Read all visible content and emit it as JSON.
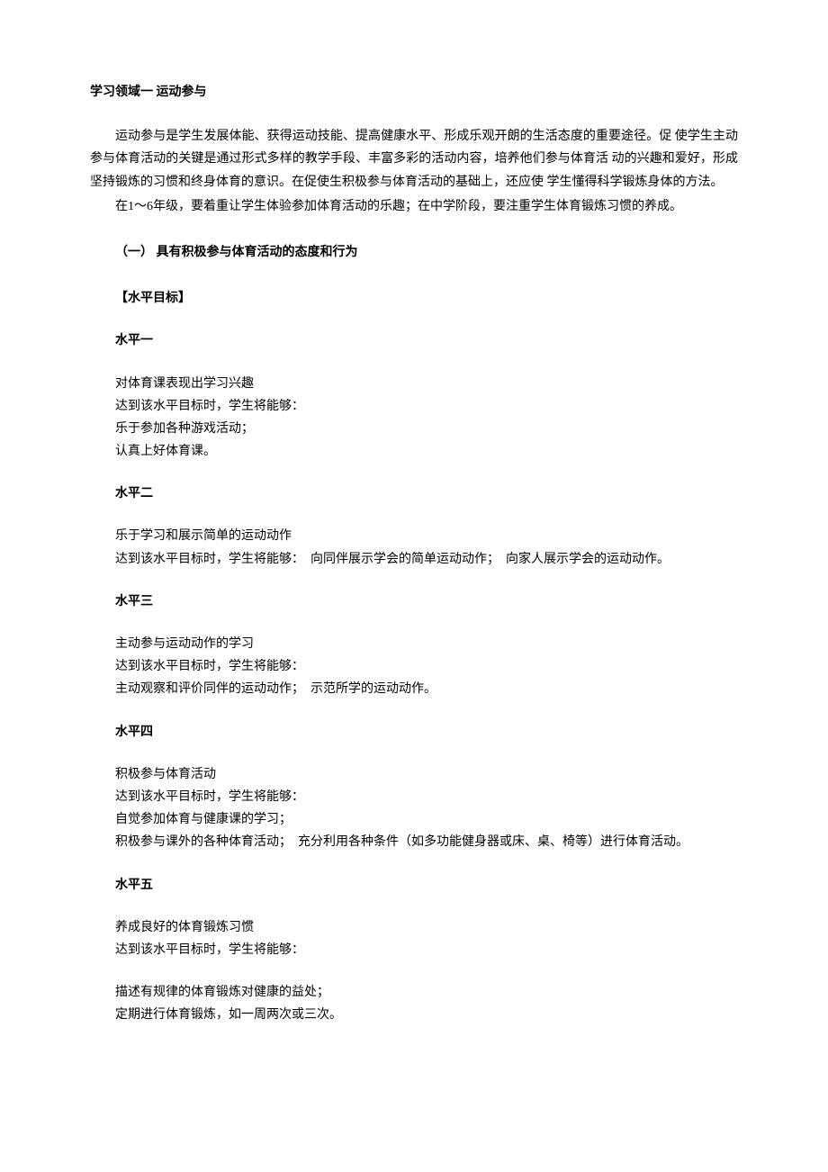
{
  "mainTitle": "学习领域一 运动参与",
  "introPara1": "运动参与是学生发展体能、获得运动技能、提高健康水平、形成乐观开朗的生活态度的重要途径。促 使学生主动参与体育活动的关键是通过形式多样的教学手段、丰富多彩的活动内容，培养他们参与体育活 动的兴趣和爱好，形成坚持锻炼的习惯和终身体育的意识。在促使生积极参与体育活动的基础上，还应使 学生懂得科学锻炼身体的方法。",
  "introPara2": "在1～6年级，要着重让学生体验参加体育活动的乐趣；在中学阶段，要注重学生体育锻炼习惯的养成。",
  "sectionTitle": "（一） 具有积极参与体育活动的态度和行为",
  "goalsTitle": "【水平目标】",
  "levels": {
    "l1": {
      "title": "水平一",
      "lines": [
        "对体育课表现出学习兴趣",
        "达到该水平目标时，学生将能够：",
        "乐于参加各种游戏活动；",
        "认真上好体育课。"
      ]
    },
    "l2": {
      "title": "水平二",
      "lines": [
        "乐于学习和展示简单的运动动作",
        "达到该水平目标时，学生将能够：　向同伴展示学会的简单运动动作；　向家人展示学会的运动动作。"
      ]
    },
    "l3": {
      "title": "水平三",
      "lines": [
        "主动参与运动动作的学习",
        "达到该水平目标时，学生将能够：",
        "主动观察和评价同伴的运动动作；　示范所学的运动动作。"
      ]
    },
    "l4": {
      "title": "水平四",
      "lines": [
        "积极参与体育活动",
        "达到该水平目标时，学生将能够：",
        "自觉参加体育与健康课的学习；",
        "积极参与课外的各种体育活动；　充分利用各种条件（如多功能健身器或床、桌、椅等）进行体育活动。"
      ]
    },
    "l5": {
      "title": "水平五",
      "block1": [
        "养成良好的体育锻炼习惯",
        "达到该水平目标时，学生将能够："
      ],
      "block2": [
        "描述有规律的体育锻炼对健康的益处；",
        "定期进行体育锻炼，如一周两次或三次。"
      ]
    }
  }
}
